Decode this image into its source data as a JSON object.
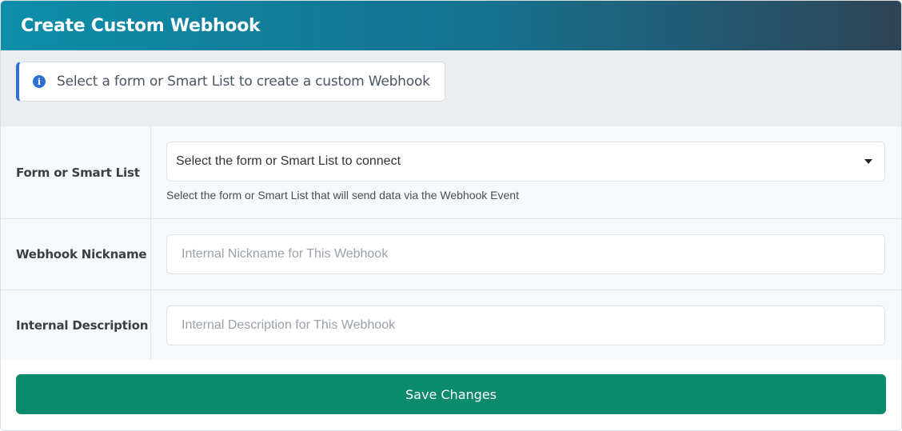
{
  "header": {
    "title": "Create Custom Webhook"
  },
  "info": {
    "icon": "info-circle-icon",
    "text": "Select a form or Smart List to create a custom Webhook"
  },
  "form": {
    "source": {
      "label": "Form or Smart List",
      "selected": "Select the form or Smart List to connect",
      "help": "Select the form or Smart List that will send data via the Webhook Event"
    },
    "nickname": {
      "label": "Webhook Nickname",
      "value": "",
      "placeholder": "Internal Nickname for This Webhook"
    },
    "description": {
      "label": "Internal Description",
      "value": "",
      "placeholder": "Internal Description for This Webhook"
    }
  },
  "footer": {
    "save_label": "Save Changes"
  },
  "colors": {
    "header_start": "#0d8ea9",
    "header_end": "#2e4457",
    "info_accent": "#2f6fd0",
    "save_button": "#0b8a6c"
  }
}
